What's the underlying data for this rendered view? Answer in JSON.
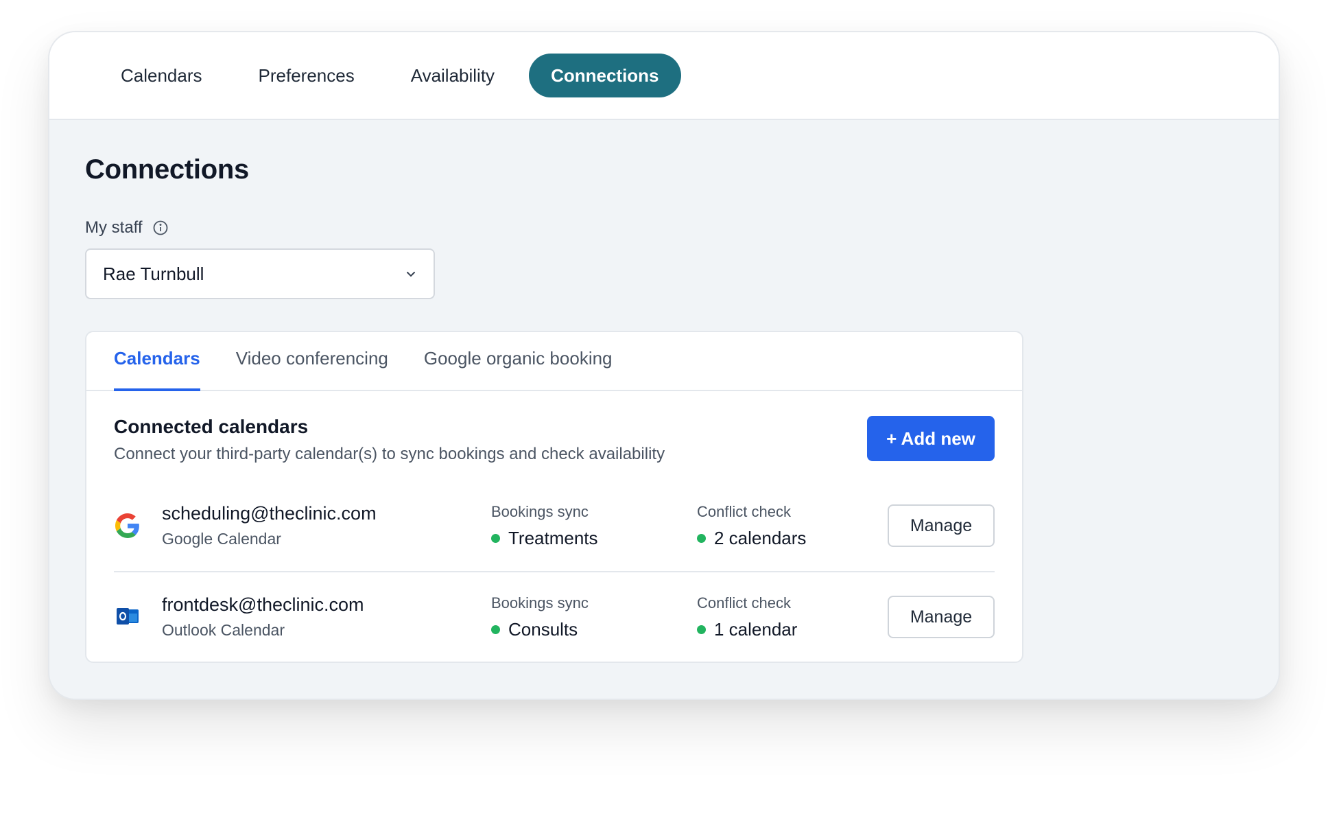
{
  "topnav": {
    "tabs": [
      {
        "label": "Calendars"
      },
      {
        "label": "Preferences"
      },
      {
        "label": "Availability"
      },
      {
        "label": "Connections",
        "active": true
      }
    ]
  },
  "page": {
    "title": "Connections",
    "staff_label": "My staff",
    "staff_selected": "Rae Turnbull",
    "info_icon": "info-circle-icon",
    "dropdown_icon": "chevron-down-icon"
  },
  "card": {
    "tabs": [
      {
        "label": "Calendars",
        "active": true
      },
      {
        "label": "Video conferencing"
      },
      {
        "label": "Google organic booking"
      }
    ],
    "section_title": "Connected calendars",
    "section_desc": "Connect your third-party calendar(s) to sync bookings and check availability",
    "add_button": "+ Add new",
    "rows": [
      {
        "icon": "google-icon",
        "email": "scheduling@theclinic.com",
        "type": "Google Calendar",
        "sync_label": "Bookings sync",
        "sync_value": "Treatments",
        "conflict_label": "Conflict check",
        "conflict_value": "2 calendars",
        "manage": "Manage"
      },
      {
        "icon": "outlook-icon",
        "email": "frontdesk@theclinic.com",
        "type": "Outlook Calendar",
        "sync_label": "Bookings sync",
        "sync_value": "Consults",
        "conflict_label": "Conflict check",
        "conflict_value": "1 calendar",
        "manage": "Manage"
      }
    ]
  },
  "colors": {
    "accent_teal": "#1e6f80",
    "primary_blue": "#2563eb",
    "status_green": "#22b45f"
  }
}
